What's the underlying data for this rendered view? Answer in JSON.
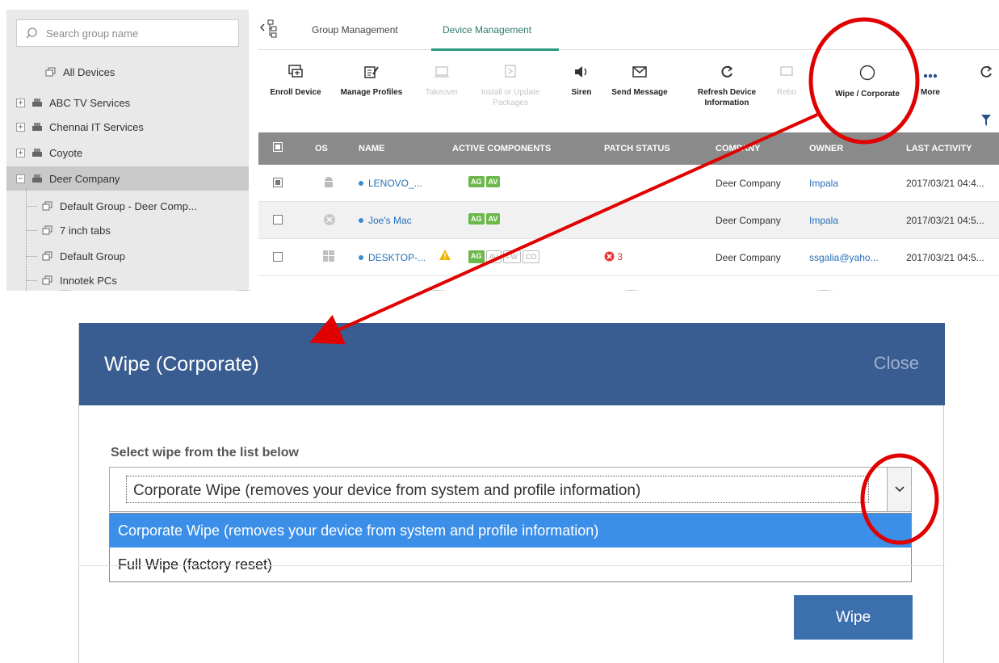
{
  "sidebar": {
    "search_placeholder": "Search group name",
    "all_devices": "All Devices",
    "items": [
      {
        "label": "ABC TV Services",
        "expander": "+"
      },
      {
        "label": "Chennai IT Services",
        "expander": "+"
      },
      {
        "label": "Coyote",
        "expander": "+"
      },
      {
        "label": "Deer Company",
        "expander": "−"
      }
    ],
    "children": [
      {
        "label": "Default Group - Deer Comp..."
      },
      {
        "label": "7 inch tabs"
      },
      {
        "label": "Default Group"
      },
      {
        "label": "Innotek PCs"
      }
    ]
  },
  "tabs": {
    "group": "Group Management",
    "device": "Device Management"
  },
  "toolbar": {
    "enroll": "Enroll Device",
    "manage": "Manage Profiles",
    "takeover": "Takeover",
    "install": "Install or Update Packages",
    "siren": "Siren",
    "send": "Send Message",
    "refresh": "Refresh Device Information",
    "reboot": "Rebo",
    "wipe": "Wipe / Corporate",
    "more": "More"
  },
  "grid": {
    "headers": {
      "os": "OS",
      "name": "NAME",
      "active": "ACTIVE COMPONENTS",
      "patch": "PATCH STATUS",
      "company": "COMPANY",
      "owner": "OWNER",
      "last": "LAST ACTIVITY"
    },
    "rows": [
      {
        "name": "LENOVO_...",
        "company": "Deer Company",
        "owner": "Impala",
        "last": "2017/03/21 04:4...",
        "chips": [
          "AG",
          "AV"
        ]
      },
      {
        "name": "Joe's Mac",
        "company": "Deer Company",
        "owner": "Impala",
        "last": "2017/03/21 04:5...",
        "chips": [
          "AG",
          "AV"
        ]
      },
      {
        "name": "DESKTOP-...",
        "company": "Deer Company",
        "owner": "ssgalia@yaho...",
        "last": "2017/03/21 04:5...",
        "chips": [
          "AG",
          "AV",
          "FW",
          "CO"
        ],
        "patch": "3"
      }
    ]
  },
  "dialog": {
    "title": "Wipe (Corporate)",
    "close": "Close",
    "label": "Select wipe from the list below",
    "selected": "Corporate Wipe (removes your device from system and profile information)",
    "options": [
      "Corporate Wipe (removes your device from system and profile information)",
      "Full Wipe (factory reset)"
    ],
    "wipe_button": "Wipe"
  },
  "colors": {
    "dialog_header": "#3a5d91",
    "accent_tab": "#2a9a7a",
    "highlight_option": "#3c8fe8",
    "annotation": "#e00000"
  }
}
